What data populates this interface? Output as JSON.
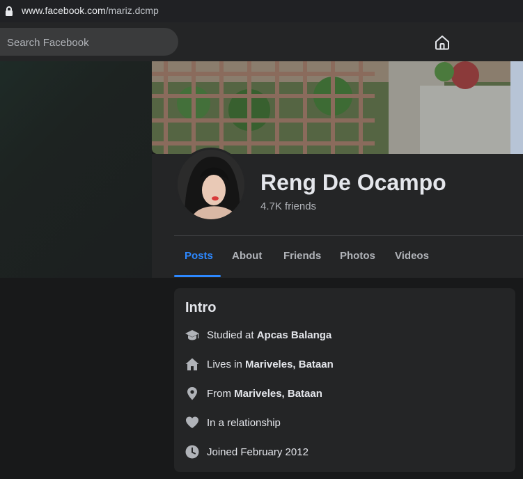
{
  "browser": {
    "url_host": "www.facebook.com",
    "url_path": "/mariz.dcmp"
  },
  "topnav": {
    "search_placeholder": "Search Facebook"
  },
  "profile": {
    "name": "Reng De Ocampo",
    "friends": "4.7K friends"
  },
  "tabs": [
    {
      "label": "Posts",
      "active": true
    },
    {
      "label": "About"
    },
    {
      "label": "Friends"
    },
    {
      "label": "Photos"
    },
    {
      "label": "Videos"
    }
  ],
  "intro": {
    "title": "Intro",
    "items": [
      {
        "icon": "graduation-cap-icon",
        "prefix": "Studied at ",
        "bold": "Apcas Balanga"
      },
      {
        "icon": "home-icon",
        "prefix": "Lives in ",
        "bold": "Mariveles, Bataan"
      },
      {
        "icon": "location-pin-icon",
        "prefix": "From ",
        "bold": "Mariveles, Bataan"
      },
      {
        "icon": "heart-icon",
        "prefix": "In a relationship",
        "bold": ""
      },
      {
        "icon": "clock-icon",
        "prefix": "Joined February 2012",
        "bold": ""
      }
    ]
  },
  "colors": {
    "accent": "#2d88ff",
    "card": "#242526",
    "page": "#18191a",
    "text": "#e4e6eb",
    "secondary_text": "#b0b3b8"
  }
}
